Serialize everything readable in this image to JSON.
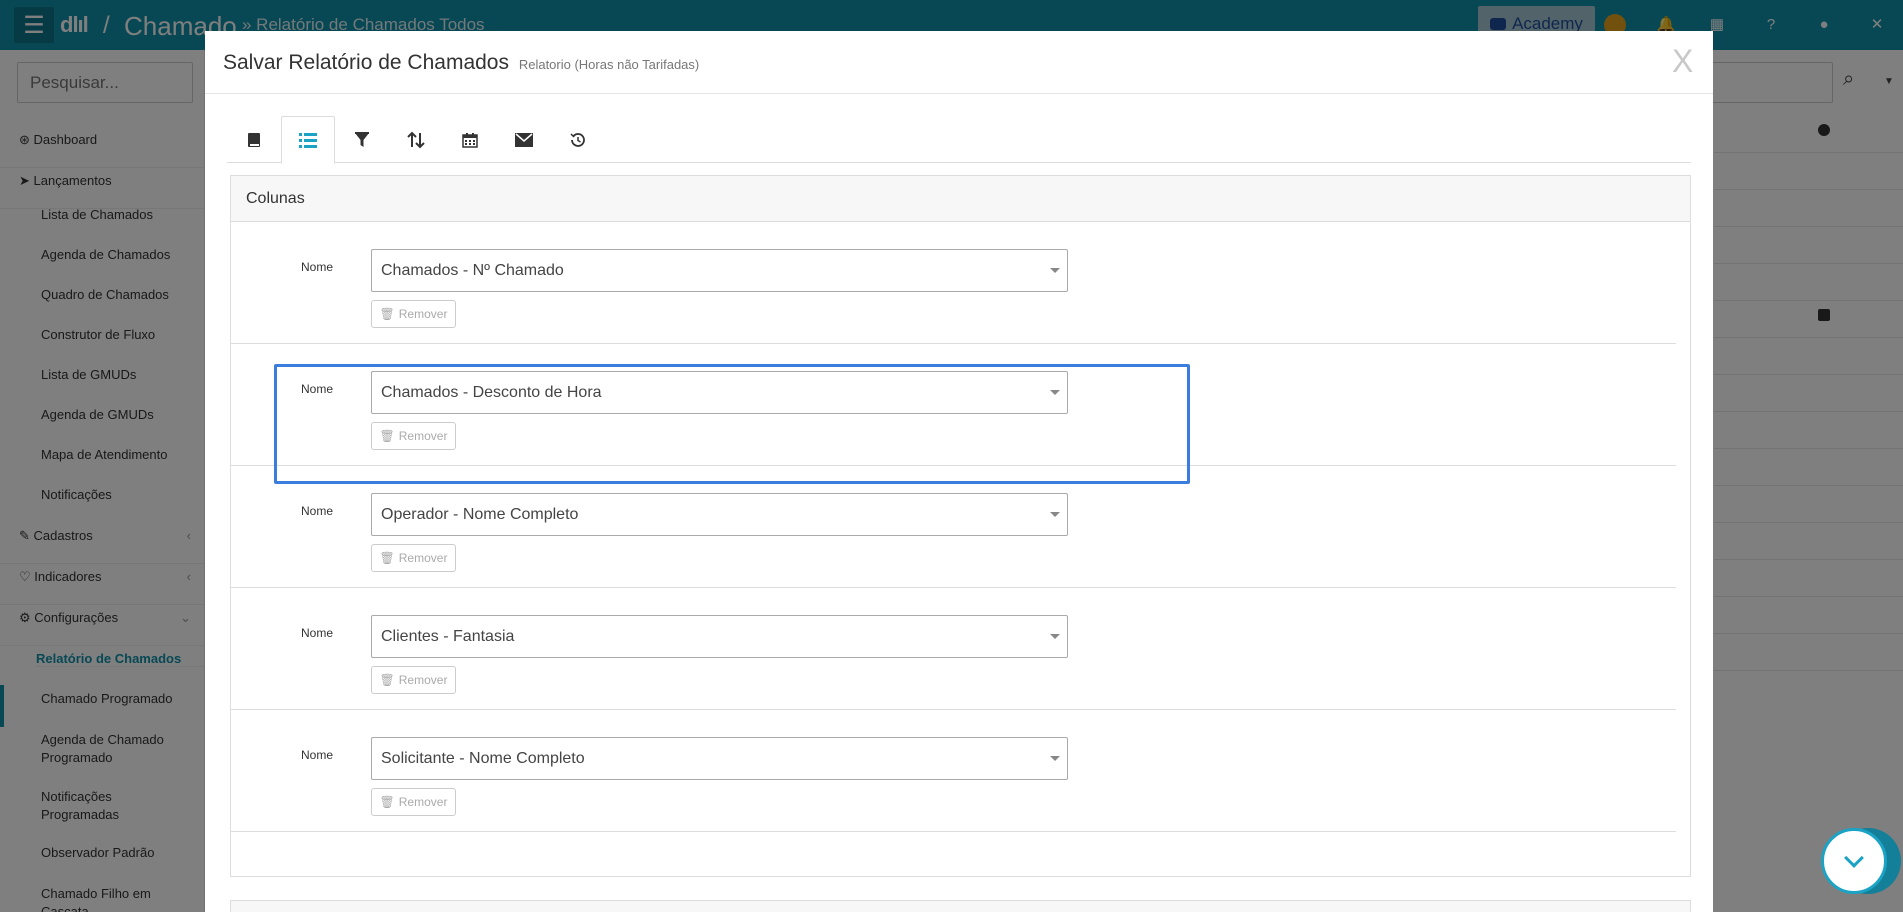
{
  "topbar": {
    "logo": "dlıl",
    "separator": "/",
    "app_title": "Chamado",
    "breadcrumb": "» Relatório de Chamados Todos",
    "academy_label": "Academy"
  },
  "sidebar": {
    "search_placeholder": "Pesquisar...",
    "items": [
      {
        "label": "Dashboard",
        "icon": "dashboard-icon"
      },
      {
        "label": "Lançamentos",
        "icon": "send-icon"
      },
      {
        "label": "Lista de Chamados"
      },
      {
        "label": "Agenda de Chamados"
      },
      {
        "label": "Quadro de Chamados"
      },
      {
        "label": "Construtor de Fluxo"
      },
      {
        "label": "Lista de GMUDs"
      },
      {
        "label": "Agenda de GMUDs"
      },
      {
        "label": "Mapa de Atendimento"
      },
      {
        "label": "Notificações"
      },
      {
        "label": "Cadastros",
        "icon": "edit-icon"
      },
      {
        "label": "Indicadores",
        "icon": "heart-icon"
      },
      {
        "label": "Configurações",
        "icon": "gear-icon"
      },
      {
        "label": "Relatório de Chamados"
      },
      {
        "label": "Chamado Programado"
      },
      {
        "label": "Agenda de Chamado Programado"
      },
      {
        "label": "Notificações Programadas"
      },
      {
        "label": "Observador Padrão"
      },
      {
        "label": "Chamado Filho em Cascata"
      }
    ]
  },
  "modal": {
    "title": "Salvar Relatório de Chamados",
    "subtitle": "Relatorio (Horas não Tarifadas)",
    "close_label": "X",
    "tabs": [
      {
        "icon": "book-icon"
      },
      {
        "icon": "list-icon",
        "active": true
      },
      {
        "icon": "filter-icon"
      },
      {
        "icon": "sort-icon"
      },
      {
        "icon": "calendar-icon"
      },
      {
        "icon": "envelope-icon"
      },
      {
        "icon": "history-icon"
      }
    ],
    "panel_title": "Colunas",
    "columns": [
      {
        "label": "Nome",
        "value": "Chamados - Nº Chamado",
        "remove_label": "Remover"
      },
      {
        "label": "Nome",
        "value": "Chamados - Desconto de Hora",
        "remove_label": "Remover"
      },
      {
        "label": "Nome",
        "value": "Operador - Nome Completo",
        "remove_label": "Remover"
      },
      {
        "label": "Nome",
        "value": "Clientes - Fantasia",
        "remove_label": "Remover"
      },
      {
        "label": "Nome",
        "value": "Solicitante - Nome Completo",
        "remove_label": "Remover"
      }
    ]
  },
  "colors": {
    "topbar": "#1190a8",
    "accent": "#1aa3c4",
    "highlight": "#3b7ddd"
  }
}
